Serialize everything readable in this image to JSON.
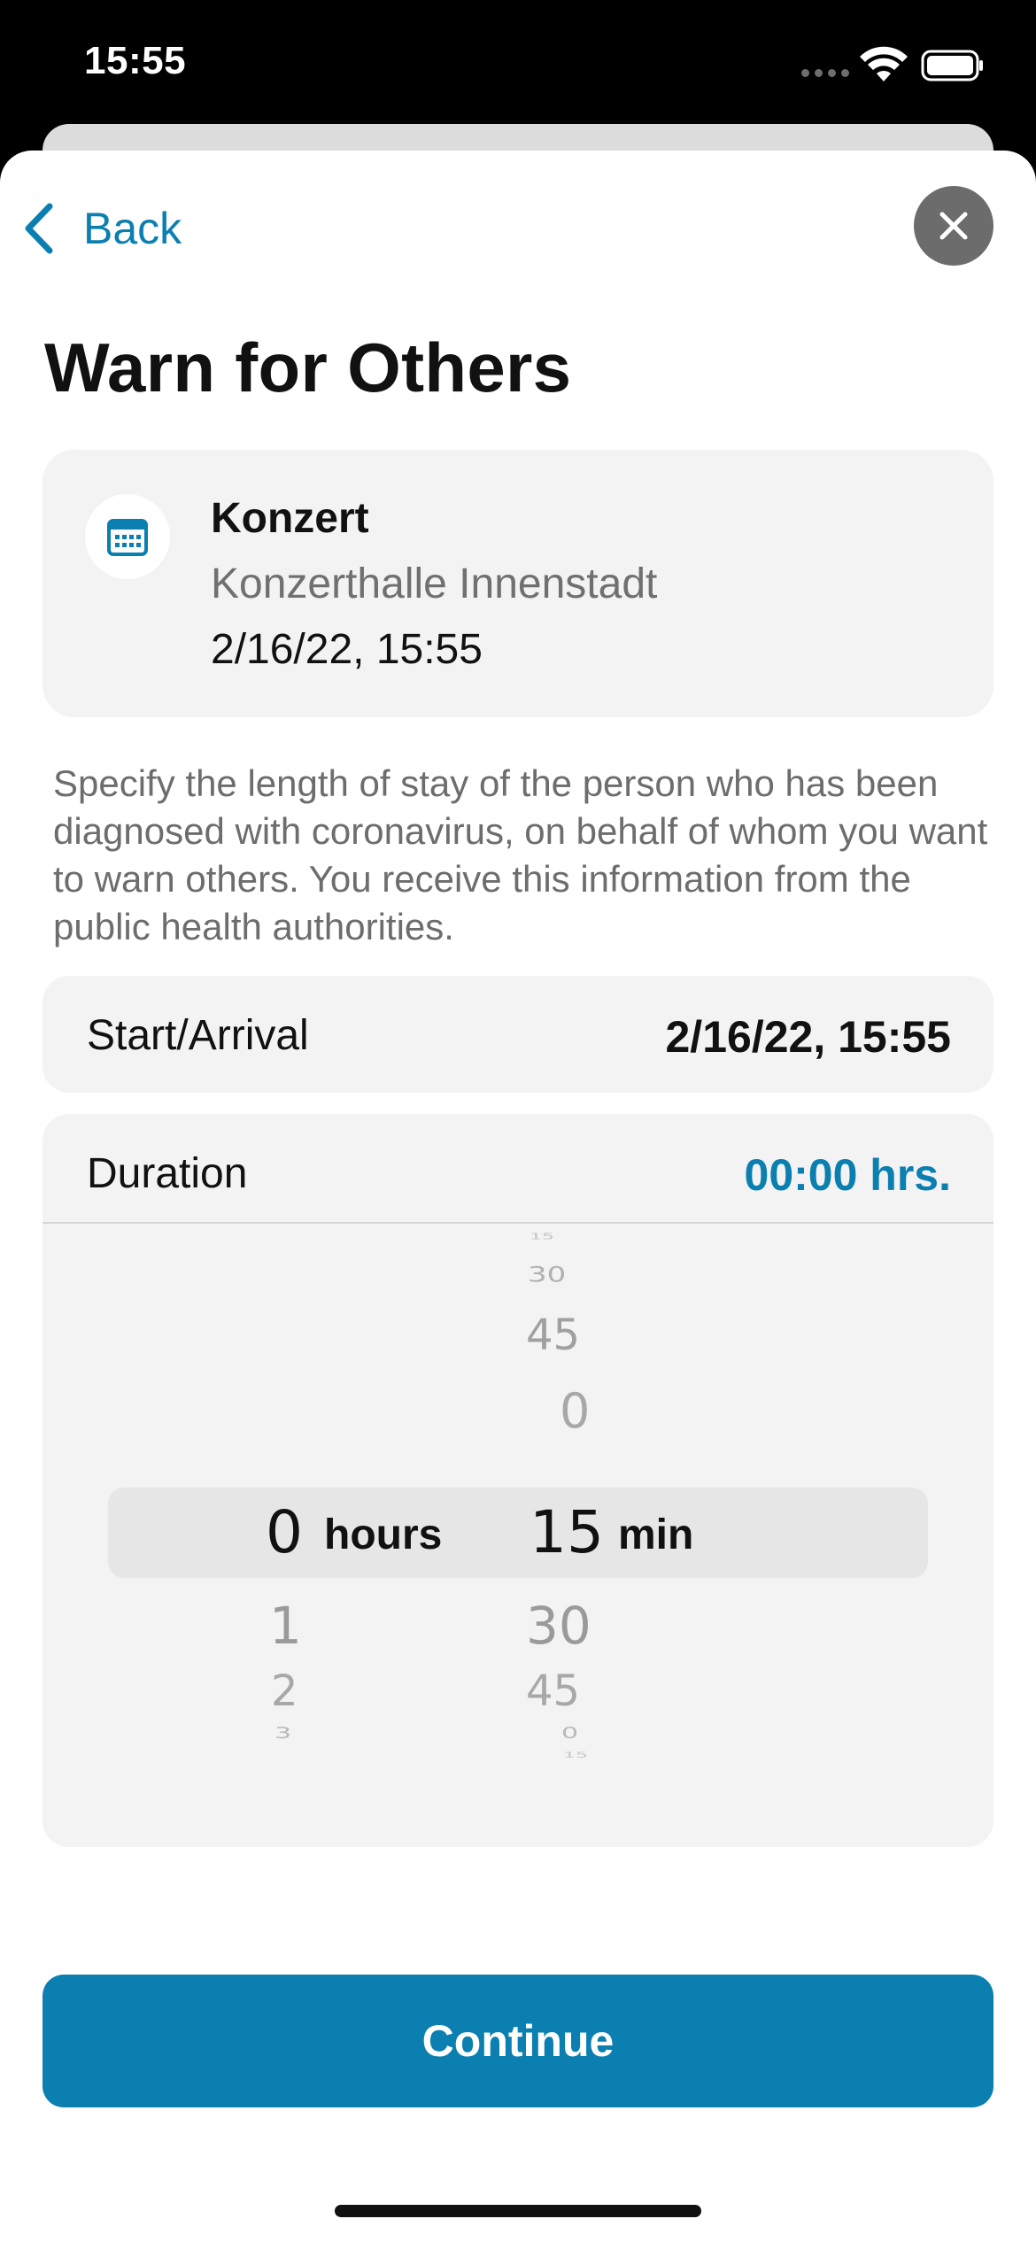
{
  "status_bar": {
    "time": "15:55"
  },
  "nav": {
    "back_label": "Back"
  },
  "page": {
    "title": "Warn for Others"
  },
  "event": {
    "icon": "calendar-icon",
    "name": "Konzert",
    "location": "Konzerthalle Innenstadt",
    "datetime": "2/16/22, 15:55"
  },
  "description": "Specify the length of stay of the person who has been diagnosed with coronavirus, on behalf of whom you want to warn others. You receive this information from the public health authorities.",
  "start": {
    "label": "Start/Arrival",
    "value": "2/16/22, 15:55"
  },
  "duration": {
    "label": "Duration",
    "value": "00:00 hrs.",
    "picker": {
      "hours_above": [],
      "hours_selected": "0",
      "hours_unit": "hours",
      "hours_below": [
        "1",
        "2",
        "3"
      ],
      "minutes_above": [
        "15",
        "30",
        "45",
        "0"
      ],
      "minutes_selected": "15",
      "minutes_unit": "min",
      "minutes_below": [
        "30",
        "45",
        "0",
        "15"
      ]
    }
  },
  "actions": {
    "continue_label": "Continue"
  },
  "colors": {
    "accent": "#0a7fb0",
    "card_bg": "#f3f3f3",
    "close_bg": "#6c6c6c"
  }
}
